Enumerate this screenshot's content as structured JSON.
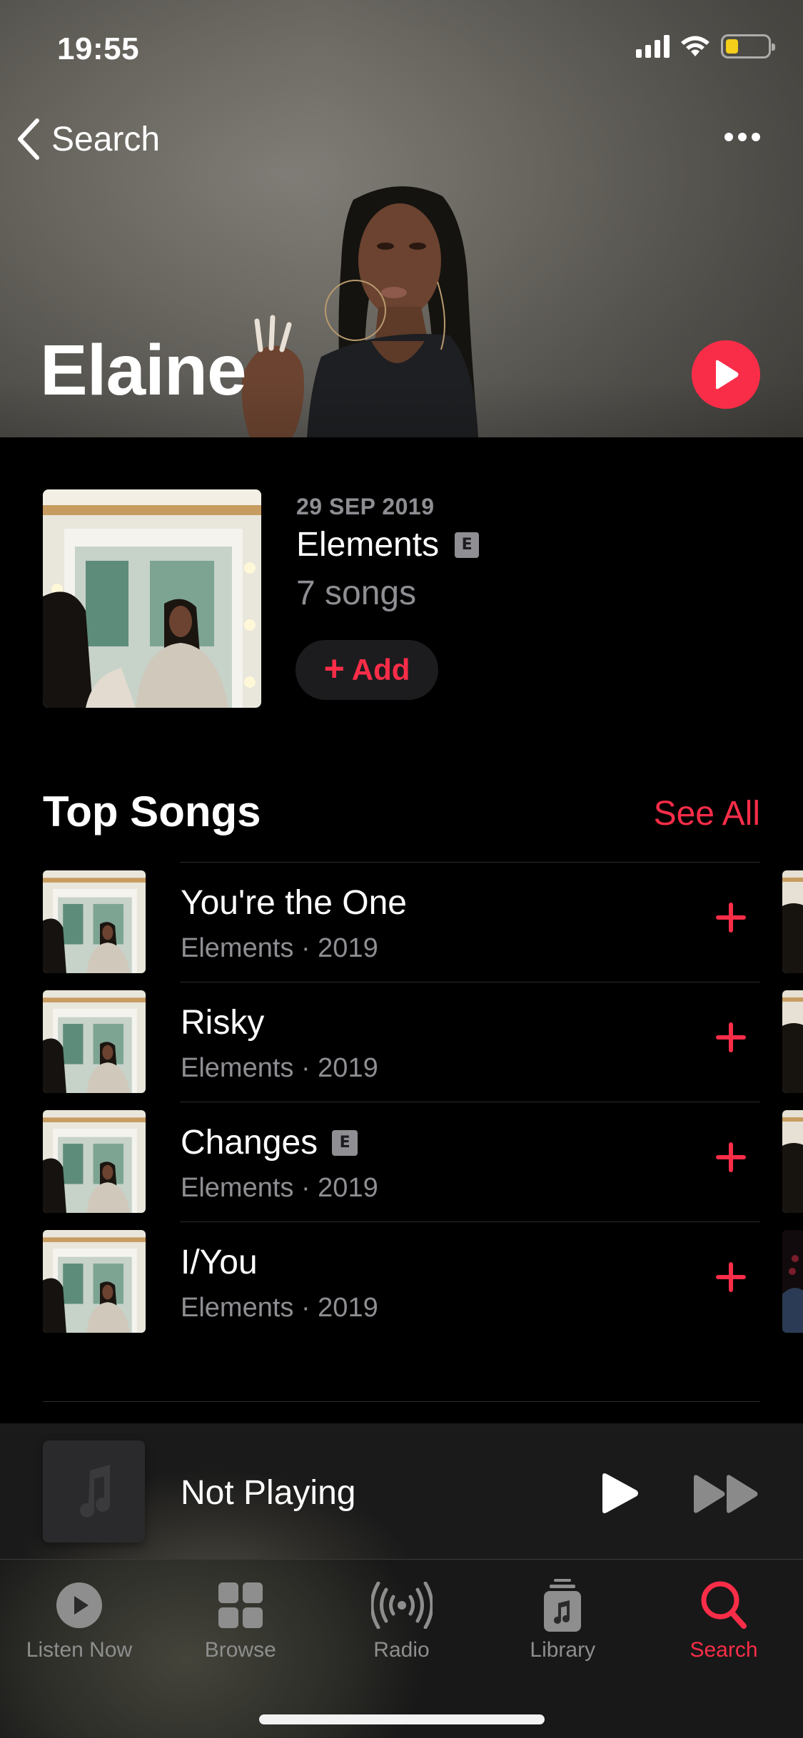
{
  "status_bar": {
    "time": "19:55",
    "icons": [
      "cellular-signal-icon",
      "wifi-icon",
      "battery-icon"
    ],
    "battery_color": "#f5cf1a",
    "battery_level": 0.3
  },
  "nav": {
    "back_label": "Search",
    "back_icon": "chevron-left-icon",
    "more_icon": "ellipsis-icon"
  },
  "artist": {
    "name": "Elaine",
    "play_icon": "play-icon"
  },
  "latest_release": {
    "date": "29 SEP 2019",
    "title": "Elements",
    "explicit_badge": "E",
    "song_count": "7 songs",
    "add_label": "Add",
    "add_icon": "plus-icon"
  },
  "top_songs": {
    "title": "Top Songs",
    "see_all": "See All",
    "items": [
      {
        "title": "You're the One",
        "subtitle": "Elements · 2019",
        "explicit": ""
      },
      {
        "title": "Risky",
        "subtitle": "Elements · 2019",
        "explicit": ""
      },
      {
        "title": "Changes",
        "subtitle": "Elements · 2019",
        "explicit": "E"
      },
      {
        "title": "I/You",
        "subtitle": "Elements · 2019",
        "explicit": ""
      }
    ]
  },
  "mini_player": {
    "title": "Not Playing",
    "art_icon": "music-note-icon",
    "play_icon": "play-icon",
    "next_icon": "fast-forward-icon"
  },
  "tab_bar": {
    "tabs": [
      {
        "label": "Listen Now",
        "icon": "listen-now-icon",
        "active": false
      },
      {
        "label": "Browse",
        "icon": "browse-grid-icon",
        "active": false
      },
      {
        "label": "Radio",
        "icon": "radio-broadcast-icon",
        "active": false
      },
      {
        "label": "Library",
        "icon": "library-icon",
        "active": false
      },
      {
        "label": "Search",
        "icon": "search-icon",
        "active": true
      }
    ]
  },
  "colors": {
    "accent": "#fa2d48",
    "secondary_text": "#8e8e93",
    "background": "#000000",
    "inactive_tab": "#8e8e8e"
  }
}
